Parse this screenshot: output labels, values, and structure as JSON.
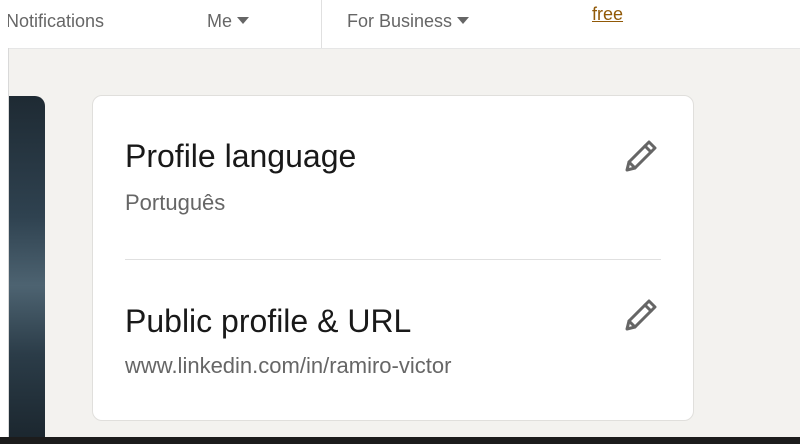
{
  "nav": {
    "notifications": "Notifications",
    "me": "Me",
    "for_business": "For Business",
    "free": "free"
  },
  "settings": {
    "profile_language": {
      "title": "Profile language",
      "value": "Português",
      "icon": "pencil-icon"
    },
    "public_profile": {
      "title": "Public profile & URL",
      "value": "www.linkedin.com/in/ramiro-victor",
      "icon": "pencil-icon"
    }
  },
  "colors": {
    "text_primary": "#191919",
    "text_secondary": "#666666",
    "link_premium": "#915907",
    "page_bg": "#f3f2ef"
  }
}
